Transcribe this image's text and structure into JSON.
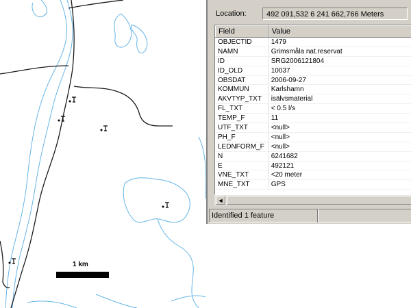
{
  "map": {
    "scale_label": "1 km"
  },
  "identify": {
    "location_label": "Location:",
    "location_value": "492 091,532  6 241 662,766 Meters",
    "columns": [
      "Field",
      "Value"
    ],
    "rows": [
      [
        "OBJECTID",
        "1479"
      ],
      [
        "NAMN",
        "Grimsmåla nat.reservat"
      ],
      [
        "ID",
        "SRG2006121804"
      ],
      [
        "ID_OLD",
        "10037"
      ],
      [
        "OBSDAT",
        "2006-09-27"
      ],
      [
        "KOMMUN",
        "Karlshamn"
      ],
      [
        "AKVTYP_TXT",
        "isälvsmaterial"
      ],
      [
        "FL_TXT",
        "< 0.5 l/s"
      ],
      [
        "TEMP_F",
        "11"
      ],
      [
        "UTF_TXT",
        "<null>"
      ],
      [
        "PH_F",
        "<null>"
      ],
      [
        "LEDNFORM_F",
        "<null>"
      ],
      [
        "N",
        "6241682"
      ],
      [
        "E",
        "492121"
      ],
      [
        "VNE_TXT",
        "<20 meter"
      ],
      [
        "MNE_TXT",
        "GPS"
      ]
    ],
    "status": "Identified 1 feature",
    "scroll_left_glyph": "◄"
  }
}
